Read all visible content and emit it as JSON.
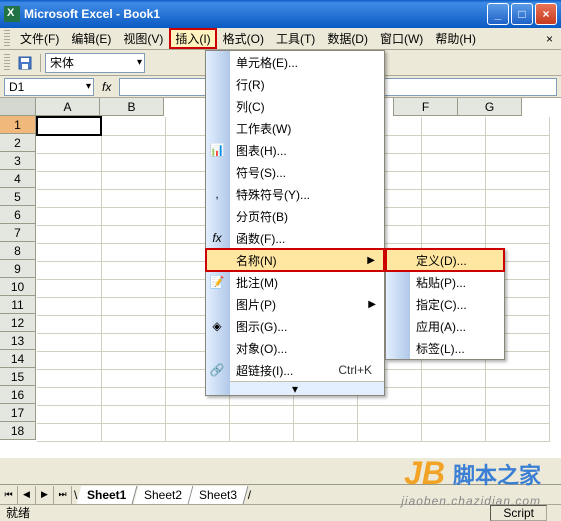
{
  "titlebar": {
    "title": "Microsoft Excel - Book1"
  },
  "menubar": {
    "file": "文件(F)",
    "edit": "编辑(E)",
    "view": "视图(V)",
    "insert": "插入(I)",
    "format": "格式(O)",
    "tools": "工具(T)",
    "data": "数据(D)",
    "window": "窗口(W)",
    "help": "帮助(H)"
  },
  "toolbar": {
    "font": "宋体"
  },
  "namebox": {
    "cell": "D1",
    "fx": "fx"
  },
  "columns": [
    "A",
    "B",
    "F",
    "G"
  ],
  "rows": [
    "1",
    "2",
    "3",
    "4",
    "5",
    "6",
    "7",
    "8",
    "9",
    "10",
    "11",
    "12",
    "13",
    "14",
    "15",
    "16",
    "17",
    "18"
  ],
  "insert_menu": {
    "cells": "单元格(E)...",
    "rows": "行(R)",
    "columns": "列(C)",
    "worksheet": "工作表(W)",
    "chart": "图表(H)...",
    "symbol": "符号(S)...",
    "special": "特殊符号(Y)...",
    "pagebreak": "分页符(B)",
    "function": "函数(F)...",
    "name": "名称(N)",
    "comment": "批注(M)",
    "picture": "图片(P)",
    "diagram": "图示(G)...",
    "object": "对象(O)...",
    "hyperlink": "超链接(I)...",
    "hyperlink_shortcut": "Ctrl+K"
  },
  "name_submenu": {
    "define": "定义(D)...",
    "paste": "粘贴(P)...",
    "create": "指定(C)...",
    "apply": "应用(A)...",
    "label": "标签(L)..."
  },
  "tabs": {
    "sheet1": "Sheet1",
    "sheet2": "Sheet2",
    "sheet3": "Sheet3"
  },
  "status": {
    "ready": "就绪",
    "script": "Script"
  },
  "watermark": {
    "logo": "JB",
    "text": "脚本之家",
    "url": "jiaoben.chazidian.com"
  }
}
